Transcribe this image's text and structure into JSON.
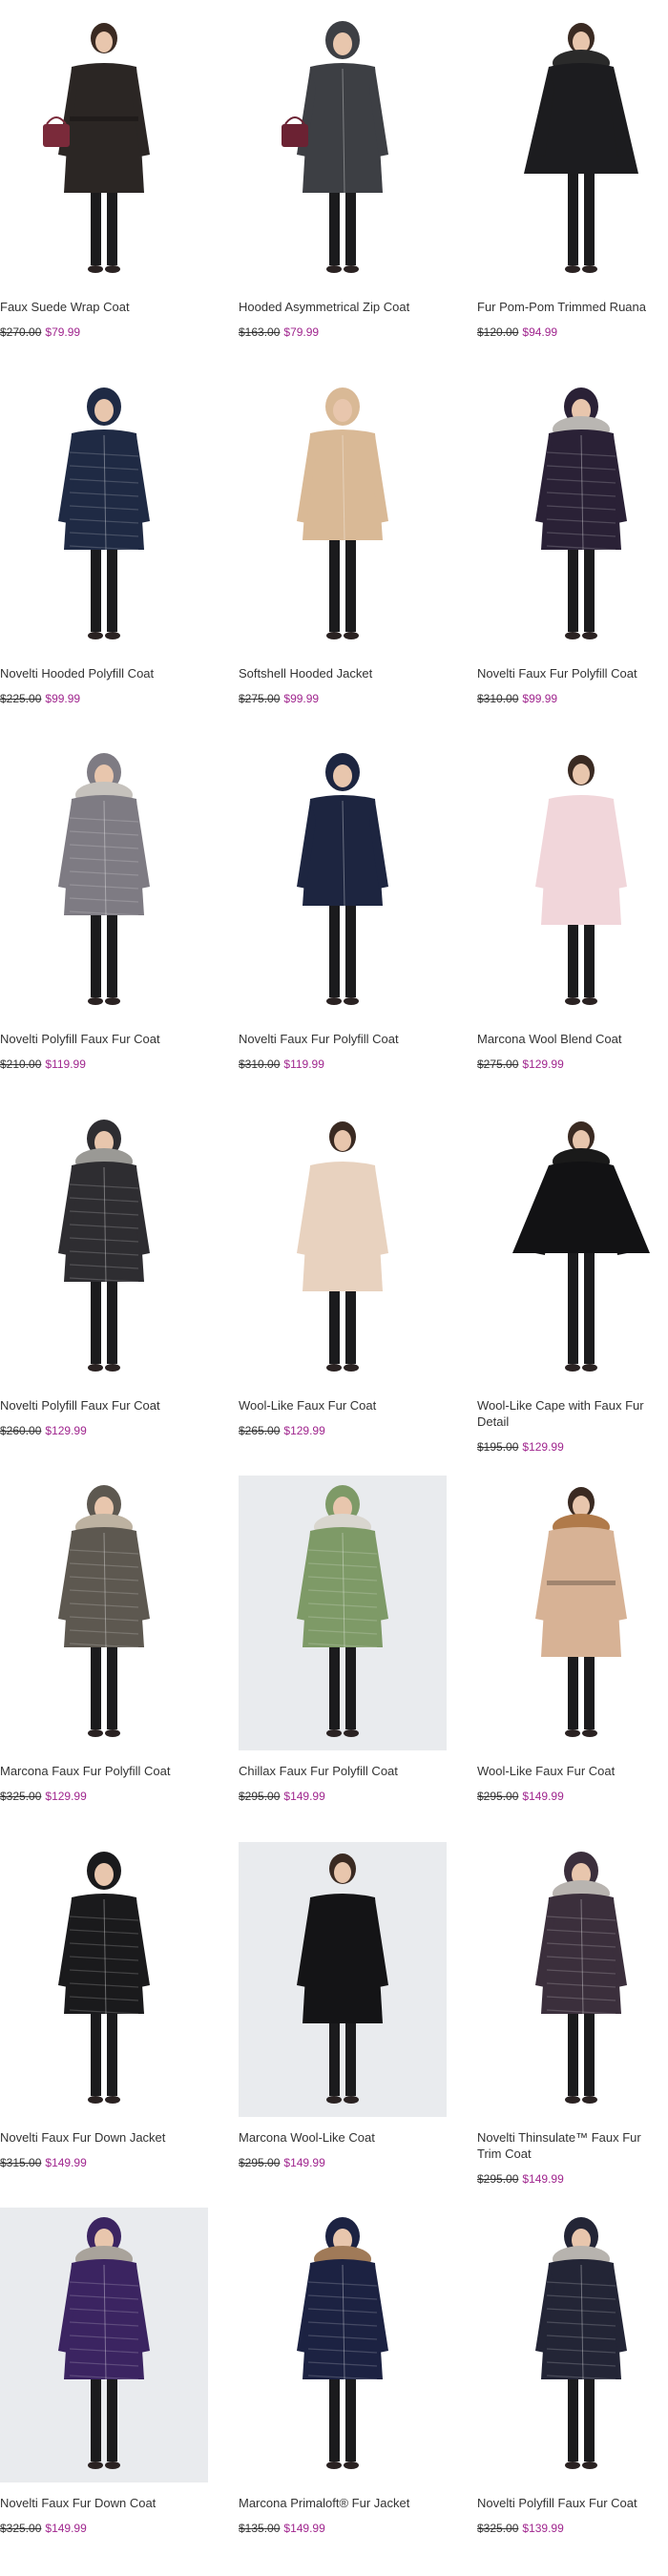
{
  "products": [
    {
      "title": "Faux Suede Wrap Coat",
      "was": "$270.00",
      "now": "$79.99",
      "coat_color": "#2b2624",
      "coat_type": "wrap-coat",
      "accent_color": "#7a2a3a",
      "background": "white",
      "photo_icon": "coat-photo-icon"
    },
    {
      "title": "Hooded Asymmetrical Zip Coat",
      "was": "$163.00",
      "now": "$79.99",
      "coat_color": "#3d3f44",
      "coat_type": "zip-coat",
      "accent_color": "#6b2233",
      "background": "white",
      "photo_icon": "coat-photo-icon"
    },
    {
      "title": "Fur Pom-Pom Trimmed Ruana",
      "was": "$120.00",
      "now": "$94.99",
      "coat_color": "#1c1c1f",
      "coat_type": "ruana",
      "accent_color": "#2a2a2a",
      "background": "white",
      "photo_icon": "coat-photo-icon"
    },
    {
      "title": "Novelti Hooded Polyfill Coat",
      "was": "$225.00",
      "now": "$99.99",
      "coat_color": "#1f2a44",
      "coat_type": "puffer-long",
      "accent_color": "#c9c9c9",
      "background": "white",
      "photo_icon": "coat-photo-icon"
    },
    {
      "title": "Softshell Hooded Jacket",
      "was": "$275.00",
      "now": "$99.99",
      "coat_color": "#d9b996",
      "coat_type": "hooded-jacket",
      "accent_color": "#cfa57a",
      "background": "white",
      "photo_icon": "coat-photo-icon"
    },
    {
      "title": "Novelti Faux Fur Polyfill Coat",
      "was": "$310.00",
      "now": "$99.99",
      "coat_color": "#2a2136",
      "coat_type": "puffer-fur",
      "accent_color": "#b9b6b2",
      "background": "white",
      "photo_icon": "coat-photo-icon"
    },
    {
      "title": "Novelti Polyfill Faux Fur Coat",
      "was": "$210.00",
      "now": "$119.99",
      "coat_color": "#7e7b83",
      "coat_type": "puffer-fur",
      "accent_color": "#c6c2bd",
      "background": "white",
      "photo_icon": "coat-photo-icon"
    },
    {
      "title": "Novelti Faux Fur Polyfill Coat",
      "was": "$310.00",
      "now": "$119.99",
      "coat_color": "#1d2540",
      "coat_type": "parka",
      "accent_color": "#3a3a3a",
      "background": "white",
      "photo_icon": "coat-photo-icon"
    },
    {
      "title": "Marcona Wool Blend Coat",
      "was": "$275.00",
      "now": "$129.99",
      "coat_color": "#f1d6da",
      "coat_type": "wool-coat",
      "accent_color": "#2a2a2a",
      "background": "white",
      "photo_icon": "coat-photo-icon"
    },
    {
      "title": "Novelti Polyfill Faux Fur Coat",
      "was": "$260.00",
      "now": "$129.99",
      "coat_color": "#2e2d31",
      "coat_type": "puffer-fur",
      "accent_color": "#9a9995",
      "background": "white",
      "photo_icon": "coat-photo-icon"
    },
    {
      "title": "Wool-Like Faux Fur Coat",
      "was": "$265.00",
      "now": "$129.99",
      "coat_color": "#e8d2bf",
      "coat_type": "wool-coat",
      "accent_color": "#d9c1ab",
      "background": "white",
      "photo_icon": "coat-photo-icon"
    },
    {
      "title": "Wool-Like Cape with Faux Fur Detail",
      "was": "$195.00",
      "now": "$129.99",
      "coat_color": "#121214",
      "coat_type": "cape",
      "accent_color": "#1a1a1a",
      "background": "white",
      "photo_icon": "coat-photo-icon"
    },
    {
      "title": "Marcona Faux Fur Polyfill Coat",
      "was": "$325.00",
      "now": "$129.99",
      "coat_color": "#5d5850",
      "coat_type": "puffer-fur",
      "accent_color": "#bdb2a1",
      "background": "white",
      "photo_icon": "coat-photo-icon"
    },
    {
      "title": "Chillax Faux Fur Polyfill Coat",
      "was": "$295.00",
      "now": "$149.99",
      "coat_color": "#7e9a67",
      "coat_type": "puffer-fur",
      "accent_color": "#d9d6cf",
      "background": "studio",
      "photo_icon": "coat-photo-icon"
    },
    {
      "title": "Wool-Like Faux Fur Coat",
      "was": "$295.00",
      "now": "$149.99",
      "coat_color": "#d7b295",
      "coat_type": "belted-fur",
      "accent_color": "#b07a4a",
      "background": "white",
      "photo_icon": "coat-photo-icon"
    },
    {
      "title": "Novelti Faux Fur Down Jacket",
      "was": "$315.00",
      "now": "$149.99",
      "coat_color": "#1a1a1c",
      "coat_type": "puffer-long",
      "accent_color": "#3a2a22",
      "background": "white",
      "photo_icon": "coat-photo-icon"
    },
    {
      "title": "Marcona Wool-Like Coat",
      "was": "$295.00",
      "now": "$149.99",
      "coat_color": "#141416",
      "coat_type": "wool-coat",
      "accent_color": "#1a1a1a",
      "background": "studio",
      "photo_icon": "coat-photo-icon"
    },
    {
      "title": "Novelti Thinsulate™ Faux Fur Trim Coat",
      "was": "$295.00",
      "now": "$149.99",
      "coat_color": "#3b2f3c",
      "coat_type": "puffer-fur",
      "accent_color": "#b8b4b0",
      "background": "white",
      "photo_icon": "coat-photo-icon"
    },
    {
      "title": "Novelti Faux Fur Down Coat",
      "was": "$325.00",
      "now": "$149.99",
      "coat_color": "#3b2461",
      "coat_type": "puffer-fur",
      "accent_color": "#a9a39b",
      "background": "studio",
      "photo_icon": "coat-photo-icon"
    },
    {
      "title": "Marcona Primaloft® Fur Jacket",
      "was": "$135.00",
      "now": "$149.99",
      "coat_color": "#1c2242",
      "coat_type": "puffer-fur",
      "accent_color": "#a07a58",
      "background": "white",
      "photo_icon": "coat-photo-icon"
    },
    {
      "title": "Novelti Polyfill Faux Fur Coat",
      "was": "$325.00",
      "now": "$139.99",
      "coat_color": "#232536",
      "coat_type": "puffer-fur",
      "accent_color": "#b7b3ae",
      "background": "white",
      "photo_icon": "coat-photo-icon"
    }
  ],
  "price_accent_color": "#a0268e"
}
